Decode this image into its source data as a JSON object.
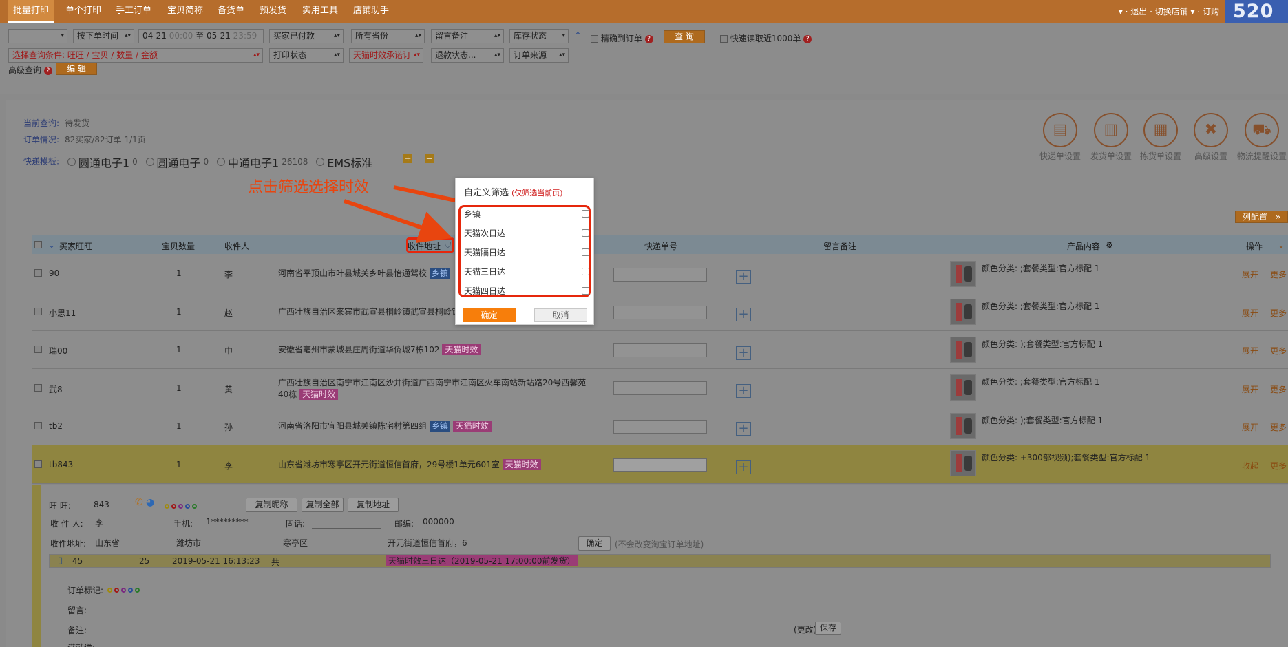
{
  "nav": {
    "tabs": [
      "批量打印",
      "单个打印",
      "手工订单",
      "宝贝简称",
      "备货单",
      "预发货",
      "实用工具",
      "店铺助手"
    ],
    "right": "▾ · 退出 · 切换店铺 ▾ · 订购",
    "logo": "520"
  },
  "filters": {
    "shop": "",
    "time_type": "按下单时间",
    "date_start": "04-21",
    "time_start": "00:00",
    "date_sep": "至",
    "date_end": "05-21",
    "time_end": "23:59",
    "pay_status": "买家已付款",
    "province": "所有省份",
    "remark": "留言备注",
    "stock": "库存状态",
    "query_cond": "选择查询条件: 旺旺 / 宝贝 / 数量 / 金额",
    "print_status": "打印状态",
    "tmall_promise": "天猫时效承诺订",
    "refund_status": "退款状态...",
    "order_source": "订单来源",
    "exact_order": "精确到订单",
    "query_btn": "查 询",
    "fast_read": "快速读取近1000单",
    "advanced": "高级查询",
    "edit_btn": "编 辑"
  },
  "summary": {
    "current_query_label": "当前查询:",
    "current_query_value": "待发货",
    "order_status_label": "订单情况:",
    "order_status_value": "82买家/82订单   1/1页",
    "template_label": "快递模板:",
    "templates": [
      {
        "name": "圆通电子1",
        "count": "0"
      },
      {
        "name": "圆通电子",
        "count": "0"
      },
      {
        "name": "中通电子1",
        "count": "26108"
      },
      {
        "name": "EMS标准",
        "count": ""
      }
    ]
  },
  "settings": [
    {
      "label": "快递单设置",
      "icon": "express-form-icon"
    },
    {
      "label": "发货单设置",
      "icon": "delivery-form-icon"
    },
    {
      "label": "拣货单设置",
      "icon": "picking-form-icon"
    },
    {
      "label": "高级设置",
      "icon": "tools-icon"
    },
    {
      "label": "物流提醒设置",
      "icon": "truck-icon"
    }
  ],
  "column_config": "列配置",
  "table": {
    "headers": {
      "buyer": "买家旺旺",
      "qty": "宝贝数量",
      "recipient": "收件人",
      "address": "收件地址",
      "tracking": "快递单号",
      "remark": "留言备注",
      "product": "产品内容",
      "op": "操作"
    },
    "rows": [
      {
        "buyer": "90",
        "qty": "1",
        "name": "李",
        "address": "河南省平顶山市叶县城关乡叶县怡通驾校",
        "tags": [
          "乡镇"
        ],
        "product": "颜色分类: ;套餐类型:官方标配 1",
        "op1": "展开",
        "op2": "更多"
      },
      {
        "buyer": "小思11",
        "qty": "1",
        "name": "赵",
        "address": "广西壮族自治区来宾市武宣县桐岭镇武宣县桐岭镇",
        "tags": [],
        "product": "颜色分类: ;套餐类型:官方标配 1",
        "op1": "展开",
        "op2": "更多"
      },
      {
        "buyer": "瑞00",
        "qty": "1",
        "name": "申",
        "address": "安徽省亳州市蒙城县庄周街道华侨城7栋102",
        "tags": [
          "天猫时效"
        ],
        "product": "颜色分类: );套餐类型:官方标配 1",
        "op1": "展开",
        "op2": "更多"
      },
      {
        "buyer": "武8",
        "qty": "1",
        "name": "黄",
        "address": "广西壮族自治区南宁市江南区沙井街道广西南宁市江南区火车南站新站路20号西馨苑40栋",
        "tags": [
          "天猫时效"
        ],
        "product": "颜色分类: ;套餐类型:官方标配 1",
        "op1": "展开",
        "op2": "更多"
      },
      {
        "buyer": "tb2",
        "qty": "1",
        "name": "孙",
        "address": "河南省洛阳市宜阳县城关镇陈宅村第四组",
        "tags": [
          "乡镇",
          "天猫时效"
        ],
        "product": "颜色分类: );套餐类型:官方标配 1",
        "op1": "展开",
        "op2": "更多"
      },
      {
        "buyer": "tb843",
        "qty": "1",
        "name": "李",
        "address": "山东省潍坊市寒亭区开元街道恒信首府，29号楼1单元601室",
        "tags": [
          "天猫时效"
        ],
        "product": "颜色分类: +300部视频);套餐类型:官方标配 1",
        "op1": "收起",
        "op2": "更多"
      }
    ]
  },
  "detail": {
    "wangwang_label": "旺    旺:",
    "wangwang_value": "843",
    "copy_nick": "复制昵称",
    "copy_all": "复制全部",
    "copy_addr": "复制地址",
    "recipient_label": "收 件 人:",
    "recipient_value": "李",
    "mobile_label": "手机:",
    "mobile_value": "1*********",
    "phone_label": "固话:",
    "phone_value": "",
    "zip_label": "邮编:",
    "zip_value": "000000",
    "addr_label": "收件地址:",
    "province": "山东省",
    "city": "潍坊市",
    "district": "寒亭区",
    "street": "开元街道恒信首府，6",
    "confirm_btn": "确定",
    "confirm_note": "(不会改变淘宝订单地址)",
    "sub_order_id": "45",
    "sub_order_id2": "25",
    "sub_time": "2019-05-21 16:13:23",
    "sub_amount": "共",
    "sub_badge": "天猫时效三日达（2019-05-21 17:00:00前发货）",
    "mark_label": "订单标记:",
    "msg_label": "留言:",
    "note_label": "备注:",
    "change_link": "(更改)",
    "save_btn": "保存",
    "gift_label": "满就送:"
  },
  "popup": {
    "title": "自定义筛选",
    "note": "(仅筛选当前页)",
    "options": [
      "乡镇",
      "天猫次日达",
      "天猫隔日达",
      "天猫三日达",
      "天猫四日达"
    ],
    "ok": "确定",
    "cancel": "取消"
  },
  "annotation": {
    "text": "点击筛选选择时效"
  },
  "colors": {
    "accent_orange": "#f77e0b",
    "highlight_red": "#e6270c",
    "annotation_text": "#e8450f"
  }
}
